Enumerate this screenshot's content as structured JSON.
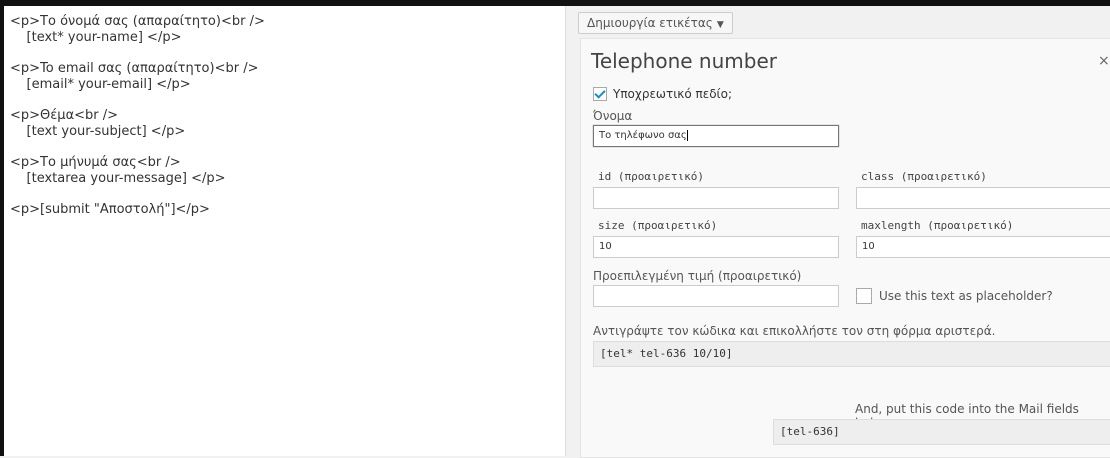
{
  "editor": {
    "blocks": [
      {
        "lines": [
          "<p>Το όνομά σας (απαραίτητο)<br />",
          "    [text* your-name] </p>"
        ]
      },
      {
        "lines": [
          "<p>To email σας (απαραίτητο)<br />",
          "    [email* your-email] </p>"
        ]
      },
      {
        "lines": [
          "<p>Θέμα<br />",
          "    [text your-subject] </p>"
        ]
      },
      {
        "lines": [
          "<p>Το μήνυμά σας<br />",
          "    [textarea your-message] </p>"
        ]
      },
      {
        "lines": [
          "<p>[submit \"Αποστολή\"]</p>"
        ]
      }
    ]
  },
  "toolbar": {
    "tag_button": "Δημιουργία ετικέτας",
    "tag_caret": "▼"
  },
  "dialog": {
    "title": "Telephone number",
    "close": "×",
    "required_label": "Υποχρεωτικό πεδίο;",
    "required_checked": true,
    "name_label": "Όνομα",
    "name_value": "Το τηλέφωνο σας",
    "id_label": "id (προαιρετικό)",
    "id_value": "",
    "class_label": "class (προαιρετικό)",
    "class_value": "",
    "size_label": "size (προαιρετικό)",
    "size_value": "10",
    "maxlength_label": "maxlength (προαιρετικό)",
    "maxlength_value": "10",
    "default_label": "Προεπιλεγμένη τιμή (προαιρετικό)",
    "default_value": "",
    "placeholder_label": "Use this text as placeholder?",
    "placeholder_checked": false,
    "copy_instruction": "Αντιγράψτε τον κώδικα και επικολλήστε τον στη φόρμα αριστερά.",
    "form_code": "[tel* tel-636 10/10]",
    "mail_instruction": "And, put this code into the Mail fields below.",
    "mail_code": "[tel-636]"
  }
}
